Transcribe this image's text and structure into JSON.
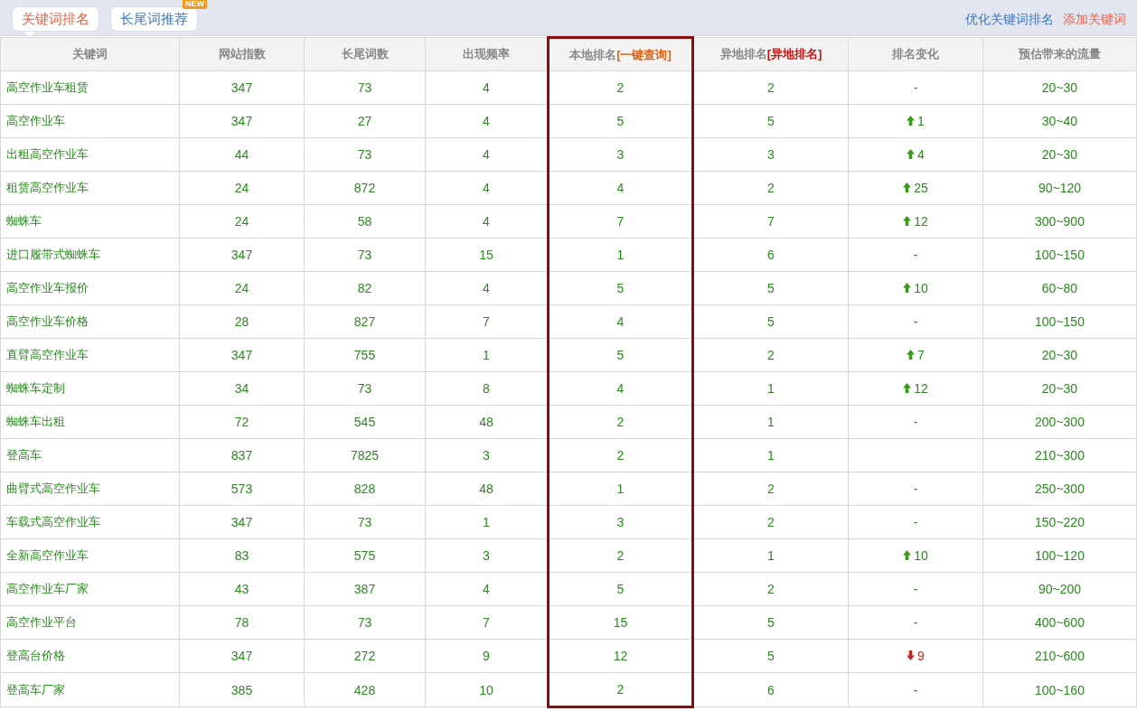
{
  "tabs": [
    {
      "label": "关键词排名",
      "selected": true
    },
    {
      "label": "长尾词推荐",
      "selected": false,
      "badge": "NEW"
    }
  ],
  "actions": [
    {
      "label": "优化关键词排名",
      "kind": "primary"
    },
    {
      "label": "添加关键词",
      "kind": "add"
    }
  ],
  "table": {
    "columns": [
      {
        "label": "关键词",
        "highlighted": false
      },
      {
        "label": "网站指数",
        "highlighted": false
      },
      {
        "label": "长尾词数",
        "highlighted": false
      },
      {
        "label": "出现频率",
        "highlighted": false
      },
      {
        "label": "本地排名",
        "link": "[一键查询]",
        "color": "#e06010",
        "highlighted": true
      },
      {
        "label": "异地排名",
        "link": "[异地排名]",
        "color": "#cc1111",
        "highlighted": false
      },
      {
        "label": "排名变化",
        "highlighted": false
      },
      {
        "label": "预估带来的流量",
        "highlighted": false
      }
    ],
    "rows": [
      {
        "keyword": "高空作业车租赁",
        "index": "347",
        "longtail": "73",
        "freq": "4",
        "local": "2",
        "remote": "2",
        "change": {
          "kind": "same",
          "text": "-"
        },
        "traffic": "20~30"
      },
      {
        "keyword": "高空作业车",
        "index": "347",
        "longtail": "27",
        "freq": "4",
        "local": "5",
        "remote": "5",
        "change": {
          "kind": "up",
          "text": "1"
        },
        "traffic": "30~40"
      },
      {
        "keyword": "出租高空作业车",
        "index": "44",
        "longtail": "73",
        "freq": "4",
        "local": "3",
        "remote": "3",
        "change": {
          "kind": "up",
          "text": "4"
        },
        "traffic": "20~30"
      },
      {
        "keyword": "租赁高空作业车",
        "index": "24",
        "longtail": "872",
        "freq": "4",
        "local": "4",
        "remote": "2",
        "change": {
          "kind": "up",
          "text": "25"
        },
        "traffic": "90~120"
      },
      {
        "keyword": "蜘蛛车",
        "index": "24",
        "longtail": "58",
        "freq": "4",
        "local": "7",
        "remote": "7",
        "change": {
          "kind": "up",
          "text": "12"
        },
        "traffic": "300~900"
      },
      {
        "keyword": "进口履带式蜘蛛车",
        "index": "347",
        "longtail": "73",
        "freq": "15",
        "local": "1",
        "remote": "6",
        "change": {
          "kind": "same",
          "text": "-"
        },
        "traffic": "100~150"
      },
      {
        "keyword": "高空作业车报价",
        "index": "24",
        "longtail": "82",
        "freq": "4",
        "local": "5",
        "remote": "5",
        "change": {
          "kind": "up",
          "text": "10"
        },
        "traffic": "60~80"
      },
      {
        "keyword": "高空作业车价格",
        "index": "28",
        "longtail": "827",
        "freq": "7",
        "local": "4",
        "remote": "5",
        "change": {
          "kind": "same",
          "text": "-"
        },
        "traffic": "100~150"
      },
      {
        "keyword": "直臂高空作业车",
        "index": "347",
        "longtail": "755",
        "freq": "1",
        "local": "5",
        "remote": "2",
        "change": {
          "kind": "up",
          "text": "7"
        },
        "traffic": "20~30"
      },
      {
        "keyword": "蜘蛛车定制",
        "index": "34",
        "longtail": "73",
        "freq": "8",
        "local": "4",
        "remote": "1",
        "change": {
          "kind": "up",
          "text": "12"
        },
        "traffic": "20~30"
      },
      {
        "keyword": "蜘蛛车出租",
        "index": "72",
        "longtail": "545",
        "freq": "48",
        "local": "2",
        "remote": "1",
        "change": {
          "kind": "same",
          "text": "-"
        },
        "traffic": "200~300"
      },
      {
        "keyword": "登高车",
        "index": "837",
        "longtail": "7825",
        "freq": "3",
        "local": "2",
        "remote": "1",
        "change": {
          "kind": "none"
        },
        "traffic": "210~300"
      },
      {
        "keyword": "曲臂式高空作业车",
        "index": "573",
        "longtail": "828",
        "freq": "48",
        "local": "1",
        "remote": "2",
        "change": {
          "kind": "same",
          "text": "-"
        },
        "traffic": "250~300"
      },
      {
        "keyword": "车载式高空作业车",
        "index": "347",
        "longtail": "73",
        "freq": "1",
        "local": "3",
        "remote": "2",
        "change": {
          "kind": "same",
          "text": "-"
        },
        "traffic": "150~220"
      },
      {
        "keyword": "全新高空作业车",
        "index": "83",
        "longtail": "575",
        "freq": "3",
        "local": "2",
        "remote": "1",
        "change": {
          "kind": "up",
          "text": "10"
        },
        "traffic": "100~120"
      },
      {
        "keyword": "高空作业车厂家",
        "index": "43",
        "longtail": "387",
        "freq": "4",
        "local": "5",
        "remote": "2",
        "change": {
          "kind": "same",
          "text": "-"
        },
        "traffic": "90~200"
      },
      {
        "keyword": "高空作业平台",
        "index": "78",
        "longtail": "73",
        "freq": "7",
        "local": "15",
        "remote": "5",
        "change": {
          "kind": "same",
          "text": "-"
        },
        "traffic": "400~600"
      },
      {
        "keyword": "登高台价格",
        "index": "347",
        "longtail": "272",
        "freq": "9",
        "local": "12",
        "remote": "5",
        "change": {
          "kind": "down",
          "text": "9"
        },
        "traffic": "210~600"
      },
      {
        "keyword": "登高车厂家",
        "index": "385",
        "longtail": "428",
        "freq": "10",
        "local": "2",
        "remote": "6",
        "change": {
          "kind": "same",
          "text": "-"
        },
        "traffic": "100~160"
      }
    ]
  }
}
